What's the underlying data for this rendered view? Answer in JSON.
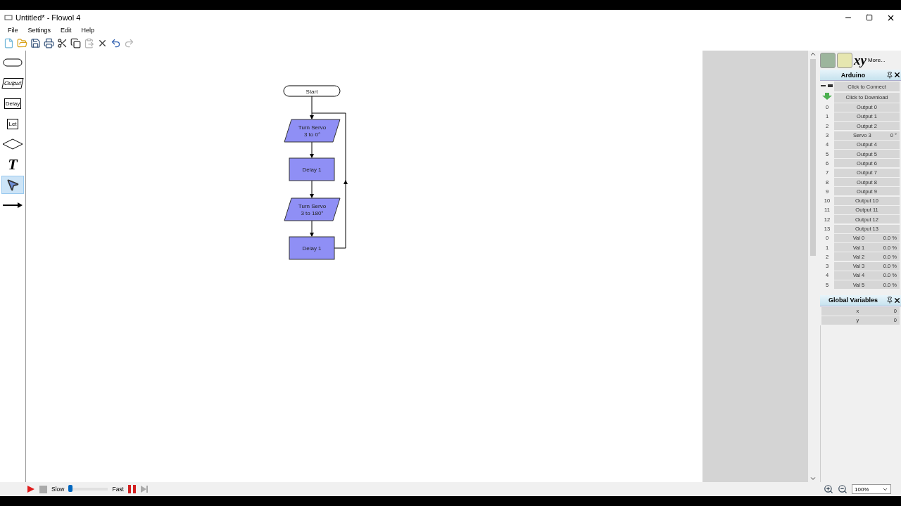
{
  "window": {
    "title": "Untitled* - Flowol 4"
  },
  "menu": [
    "File",
    "Settings",
    "Edit",
    "Help"
  ],
  "toolbar": [
    {
      "kind": "new",
      "disabled": false
    },
    {
      "kind": "open",
      "disabled": false
    },
    {
      "kind": "save",
      "disabled": false
    },
    {
      "kind": "print",
      "disabled": false
    },
    {
      "kind": "cut",
      "disabled": false
    },
    {
      "kind": "copy",
      "disabled": false
    },
    {
      "kind": "paste",
      "disabled": true
    },
    {
      "kind": "delete",
      "disabled": false
    },
    {
      "kind": "undo",
      "disabled": false
    },
    {
      "kind": "redo",
      "disabled": true
    }
  ],
  "palette": [
    {
      "kind": "start",
      "selected": false
    },
    {
      "kind": "output",
      "label": "Output",
      "selected": false
    },
    {
      "kind": "process",
      "label": "Delay",
      "selected": false
    },
    {
      "kind": "process",
      "label": "Let",
      "selected": false
    },
    {
      "kind": "decision",
      "selected": false
    },
    {
      "kind": "text",
      "label": "T",
      "selected": false
    },
    {
      "kind": "pointer",
      "selected": true
    },
    {
      "kind": "arrow",
      "selected": false
    }
  ],
  "flowchart": {
    "nodes": [
      {
        "kind": "terminal",
        "lines": [
          "Start"
        ]
      },
      {
        "kind": "output",
        "lines": [
          "Turn Servo",
          "3 to 0°"
        ]
      },
      {
        "kind": "process",
        "lines": [
          "Delay 1"
        ]
      },
      {
        "kind": "output",
        "lines": [
          "Turn Servo",
          "3 to 180°"
        ]
      },
      {
        "kind": "process",
        "lines": [
          "Delay 1"
        ]
      }
    ]
  },
  "panel_top": {
    "label": "xy",
    "more": "More..."
  },
  "arduino": {
    "title": "Arduino",
    "connect": "Click to Connect",
    "download": "Click to Download",
    "rows": [
      {
        "kind": "output",
        "number": "0",
        "label": "Output 0"
      },
      {
        "kind": "output",
        "number": "1",
        "label": "Output 1"
      },
      {
        "kind": "output",
        "number": "2",
        "label": "Output 2"
      },
      {
        "kind": "servo",
        "number": "3",
        "label": "Servo 3",
        "value": "0 °"
      },
      {
        "kind": "output",
        "number": "4",
        "label": "Output 4"
      },
      {
        "kind": "output",
        "number": "5",
        "label": "Output 5"
      },
      {
        "kind": "output",
        "number": "6",
        "label": "Output 6"
      },
      {
        "kind": "output",
        "number": "7",
        "label": "Output 7"
      },
      {
        "kind": "output",
        "number": "8",
        "label": "Output 8"
      },
      {
        "kind": "output",
        "number": "9",
        "label": "Output 9"
      },
      {
        "kind": "output",
        "number": "10",
        "label": "Output 10"
      },
      {
        "kind": "output",
        "number": "11",
        "label": "Output 11"
      },
      {
        "kind": "output",
        "number": "12",
        "label": "Output 12"
      },
      {
        "kind": "output",
        "number": "13",
        "label": "Output 13"
      },
      {
        "kind": "input",
        "number": "0",
        "label": "Val 0",
        "value": "0.0 %"
      },
      {
        "kind": "input",
        "number": "1",
        "label": "Val 1",
        "value": "0.0 %"
      },
      {
        "kind": "input",
        "number": "2",
        "label": "Val 2",
        "value": "0.0 %"
      },
      {
        "kind": "input",
        "number": "3",
        "label": "Val 3",
        "value": "0.0 %"
      },
      {
        "kind": "input",
        "number": "4",
        "label": "Val 4",
        "value": "0.0 %"
      },
      {
        "kind": "input",
        "number": "5",
        "label": "Val 5",
        "value": "0.0 %"
      }
    ]
  },
  "global_variables": {
    "title": "Global Variables",
    "rows": [
      {
        "name": "x",
        "value": "0"
      },
      {
        "name": "y",
        "value": "0"
      }
    ]
  },
  "run_bar": {
    "play_disabled": false,
    "stop_disabled": true,
    "slow": "Slow",
    "fast": "Fast",
    "speed": {
      "level": 0.05
    },
    "pause_disabled": false,
    "step_disabled": true
  },
  "zoom": {
    "value": "100%"
  }
}
